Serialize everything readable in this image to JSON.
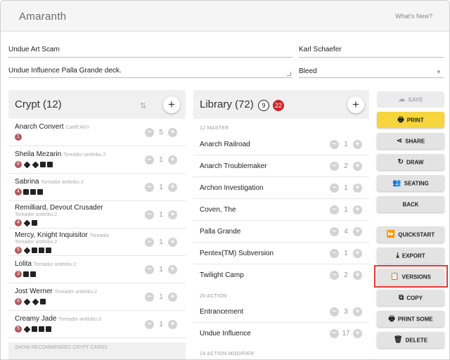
{
  "app": {
    "title": "Amaranth",
    "whats_new": "What's New?"
  },
  "deck": {
    "name": "Undue Art Scam",
    "author": "Karl Schaefer",
    "description": "Undue Influence Palla Grande deck.",
    "format": "Bleed"
  },
  "crypt": {
    "title": "Crypt (12)",
    "add_label": "+",
    "sort_icon": "sort-icon",
    "footer": "SHOW RECOMMENDED CRYPT CARDS",
    "cards": [
      {
        "name": "Anarch Convert",
        "sub": "Caitiff:ANY",
        "cap": "1",
        "qty": "5"
      },
      {
        "name": "Sheila Mezarin",
        "sub": "Toreador antitribu:2",
        "cap": "6",
        "qty": "1"
      },
      {
        "name": "Sabrina",
        "sub": "Toreador antitribu:3",
        "cap": "4",
        "qty": "1"
      },
      {
        "name": "Remilliard, Devout Crusader",
        "sub": "Toreador antitribu:2",
        "cap": "4",
        "qty": "1"
      },
      {
        "name": "Mercy, Knight Inquisitor",
        "sub": "Toreador antitribu:2",
        "cap": "5",
        "qty": "1"
      },
      {
        "name": "Lolita",
        "sub": "Toreador antitribu:2",
        "cap": "3",
        "qty": "1"
      },
      {
        "name": "Jost Werner",
        "sub": "Toreador antitribu:2",
        "cap": "6",
        "qty": "1"
      },
      {
        "name": "Creamy Jade",
        "sub": "Toreador antitribu:3",
        "cap": "5",
        "qty": "1"
      }
    ]
  },
  "library": {
    "title": "Library (72)",
    "count_a": "9",
    "count_b": "22",
    "add_label": "+",
    "sections": [
      {
        "label": "12 MASTER"
      },
      {
        "label": "20 ACTION"
      },
      {
        "label": "18 ACTION MODIFIER"
      }
    ],
    "cards": [
      {
        "name": "Anarch Railroad",
        "qty": "1"
      },
      {
        "name": "Anarch Troublemaker",
        "qty": "2"
      },
      {
        "name": "Archon Investigation",
        "qty": "1"
      },
      {
        "name": "Coven, The",
        "qty": "1"
      },
      {
        "name": "Palla Grande",
        "qty": "4"
      },
      {
        "name": "Pentex(TM) Subversion",
        "qty": "1"
      },
      {
        "name": "Twilight Camp",
        "qty": "2"
      },
      {
        "name": "Entrancement",
        "qty": "3"
      },
      {
        "name": "Undue Influence",
        "qty": "17"
      }
    ]
  },
  "actions": {
    "save": "SAVE",
    "print": "PRINT",
    "share": "SHARE",
    "draw": "DRAW",
    "seating": "SEATING",
    "back": "BACK",
    "quickstart": "QUICKSTART",
    "export": "EXPORT",
    "versions": "VERSIONS",
    "copy": "COPY",
    "print_some": "PRINT SOME",
    "delete": "DELETE"
  },
  "colors": {
    "accent_yellow": "#f6d53d",
    "highlight_red": "#e53935",
    "badge_red": "#c62828"
  }
}
